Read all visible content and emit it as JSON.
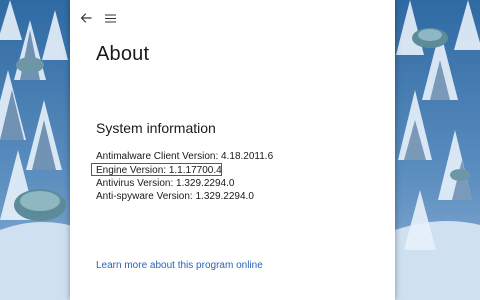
{
  "window": {
    "page_title": "About",
    "section_title": "System information"
  },
  "system_info": {
    "lines": [
      "Antimalware Client Version: 4.18.2011.6",
      "Engine Version: 1.1.17700.4",
      "Antivirus Version: 1.329.2294.0",
      "Anti-spyware Version: 1.329.2294.0"
    ],
    "highlighted_index": 1,
    "highlight_color": "#d42626"
  },
  "links": {
    "learn_more": "Learn more about this program online"
  },
  "icons": {
    "back": "back-arrow-icon",
    "menu": "hamburger-menu-icon"
  },
  "colors": {
    "link": "#2a63b8",
    "window_bg": "#ffffff",
    "wallpaper_sky": "#3d74a8"
  }
}
